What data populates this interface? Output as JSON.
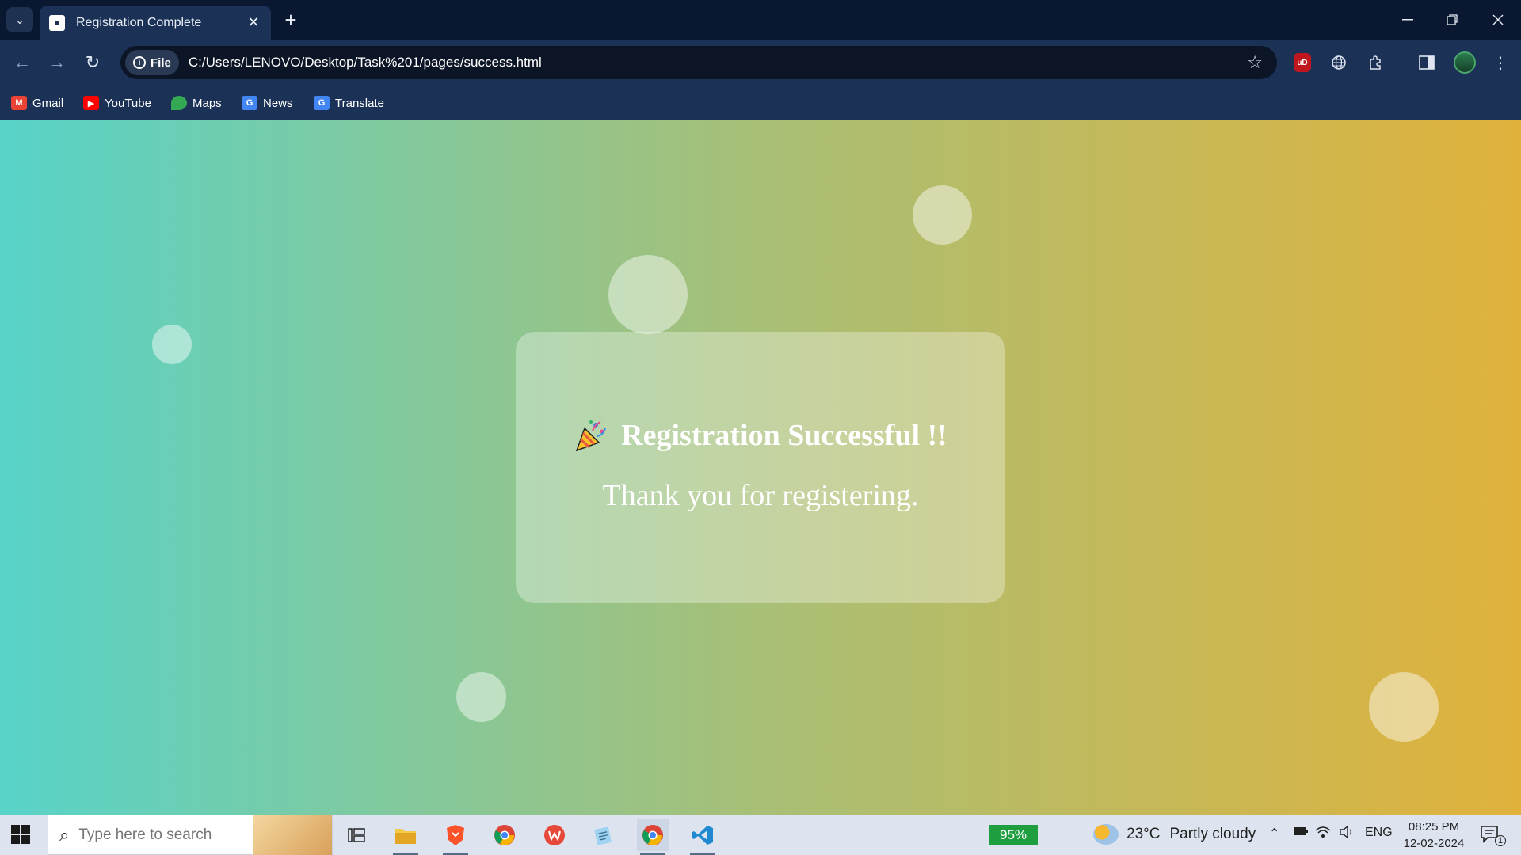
{
  "browser": {
    "tab_title": "Registration Complete",
    "tab_close": "✕",
    "new_tab": "+",
    "address_chip": "File",
    "url": "C:/Users/LENOVO/Desktop/Task%201/pages/success.html",
    "extension_ublock": "uD",
    "bookmarks": [
      {
        "label": "Gmail",
        "icon": "gmail-icon",
        "color": "#ea4335"
      },
      {
        "label": "YouTube",
        "icon": "youtube-icon",
        "color": "#ff0000"
      },
      {
        "label": "Maps",
        "icon": "maps-icon",
        "color": "#34a853"
      },
      {
        "label": "News",
        "icon": "news-icon",
        "color": "#4285f4"
      },
      {
        "label": "Translate",
        "icon": "translate-icon",
        "color": "#4285f4"
      }
    ]
  },
  "page": {
    "title": "Registration Successful !!",
    "message": "Thank you for registering."
  },
  "taskbar": {
    "search_placeholder": "Type here to search",
    "battery_percent": "95%",
    "weather_temp": "23°C",
    "weather_desc": "Partly cloudy",
    "language": "ENG",
    "time": "08:25 PM",
    "date": "12-02-2024",
    "notification_count": "1"
  },
  "colors": {
    "gradient_start": "#58d4c9",
    "gradient_end": "#e0b23c",
    "chrome_bg": "#1b3156"
  }
}
